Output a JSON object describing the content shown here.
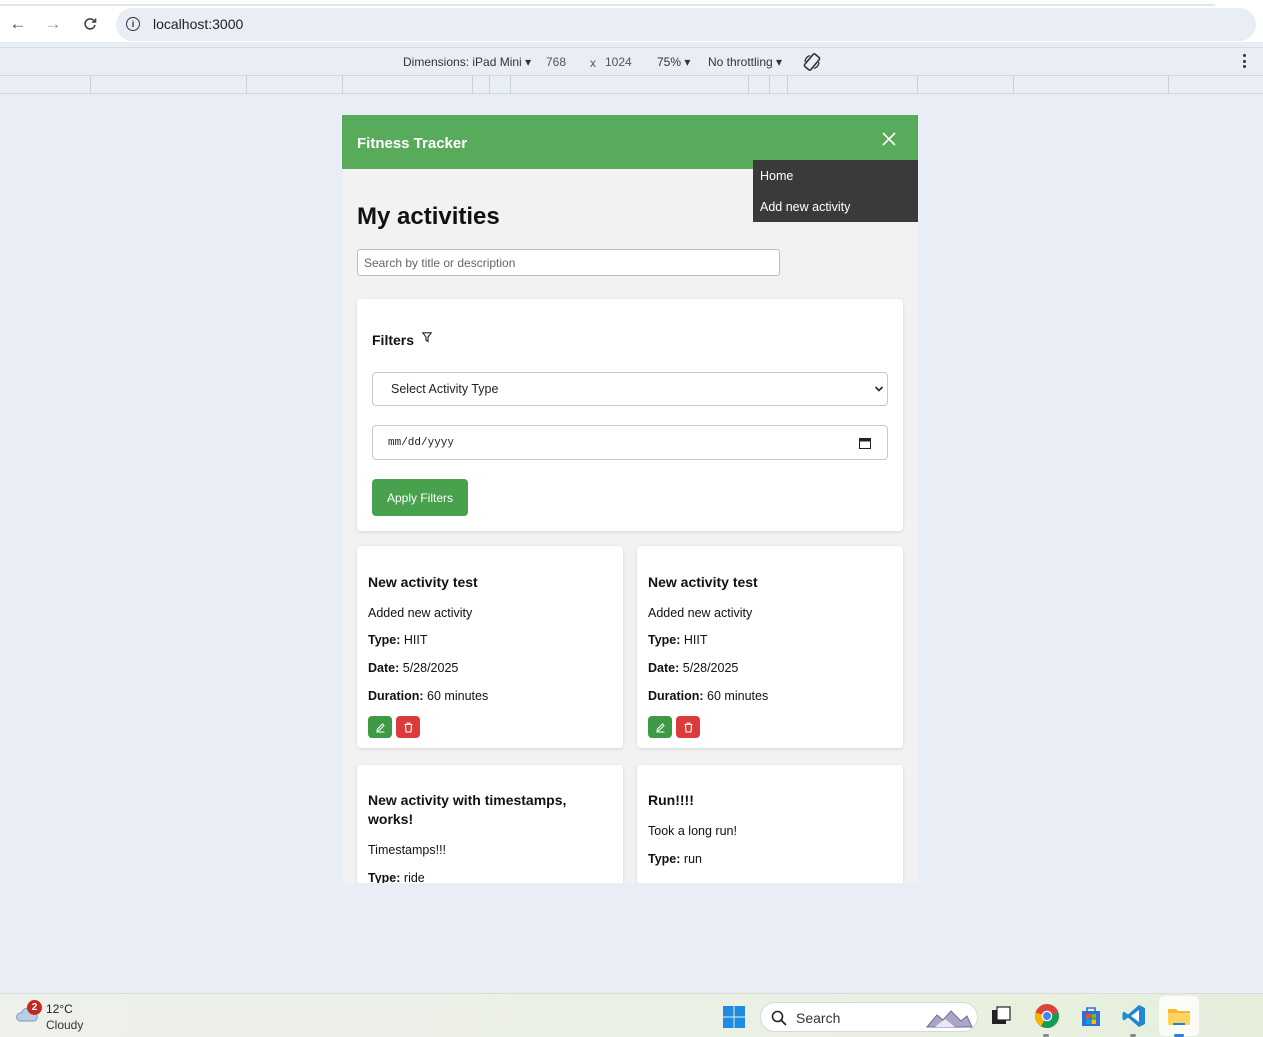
{
  "browser": {
    "url": "localhost:3000"
  },
  "devtools": {
    "dimensions_label": "Dimensions: iPad Mini",
    "width": "768",
    "times": "x",
    "height": "1024",
    "zoom": "75%",
    "throttling": "No throttling"
  },
  "app": {
    "title": "Fitness Tracker",
    "colors": {
      "header": "#59ab5c",
      "menu": "#3a3a3a",
      "edit": "#3f9a45",
      "delete": "#dc3b3b"
    },
    "menu": [
      "Home",
      "Add new activity"
    ],
    "heading": "My activities",
    "search_placeholder": "Search by title or description",
    "filters": {
      "label": "Filters",
      "activity_type_selected": "Select Activity Type",
      "date_placeholder": "mm/dd/yyyy",
      "apply_label": "Apply Filters"
    },
    "labels": {
      "type": "Type:",
      "date": "Date:",
      "duration": "Duration:"
    },
    "activities": [
      {
        "title": "New activity test",
        "description": "Added new activity",
        "type": "HIIT",
        "date": "5/28/2025",
        "duration": "60 minutes"
      },
      {
        "title": "New activity test",
        "description": "Added new activity",
        "type": "HIIT",
        "date": "5/28/2025",
        "duration": "60 minutes"
      },
      {
        "title": "New activity with timestamps, works!",
        "description": "Timestamps!!!",
        "type": "ride"
      },
      {
        "title": "Run!!!!",
        "description": "Took a long run!",
        "type": "run"
      }
    ]
  },
  "taskbar": {
    "weather_badge": "2",
    "temperature": "12°C",
    "condition": "Cloudy",
    "search_label": "Search"
  }
}
